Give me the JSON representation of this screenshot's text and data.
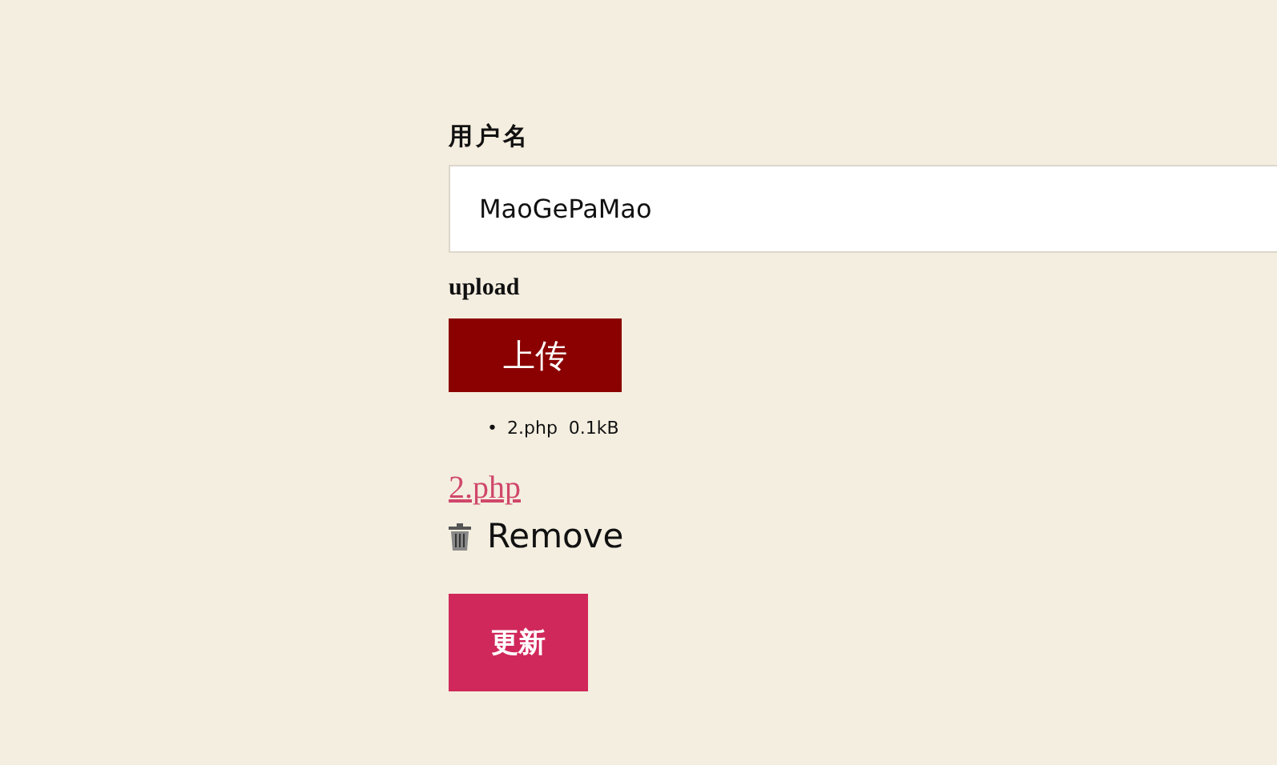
{
  "username": {
    "label": "用户名",
    "value": "MaoGePaMao"
  },
  "upload": {
    "label": "upload",
    "button": "上传",
    "files": [
      {
        "marker": "•",
        "name": "2.php",
        "size": "0.1kB"
      }
    ],
    "link": "2.php",
    "remove": "Remove"
  },
  "submit": "更新"
}
